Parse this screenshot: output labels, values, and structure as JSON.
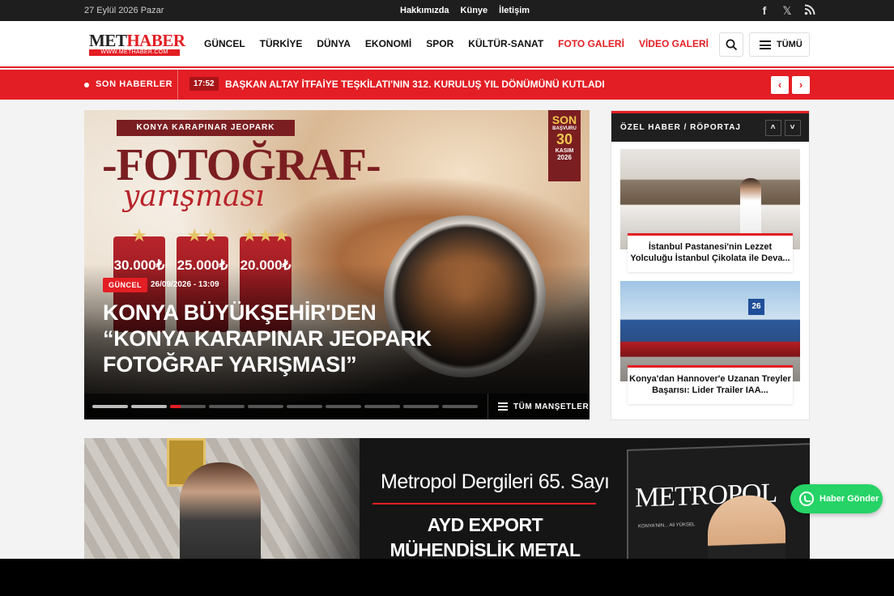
{
  "topbar": {
    "date": "27 Eylül 2026 Pazar",
    "links": [
      "Hakkımızda",
      "Künye",
      "İletişim"
    ],
    "social": [
      {
        "icon": "facebook-icon",
        "glyph": "f"
      },
      {
        "icon": "x-twitter-icon",
        "glyph": "𝕏"
      },
      {
        "icon": "rss-icon",
        "glyph": "◠"
      }
    ]
  },
  "header": {
    "logo_main": "METHABER",
    "logo_sub": "WWW.METHABER.COM",
    "nav": [
      {
        "label": "GÜNCEL",
        "highlight": false
      },
      {
        "label": "TÜRKİYE",
        "highlight": false
      },
      {
        "label": "DÜNYA",
        "highlight": false
      },
      {
        "label": "EKONOMİ",
        "highlight": false
      },
      {
        "label": "SPOR",
        "highlight": false
      },
      {
        "label": "KÜLTÜR-SANAT",
        "highlight": false
      },
      {
        "label": "FOTO GALERİ",
        "highlight": true
      },
      {
        "label": "VİDEO GALERİ",
        "highlight": true
      }
    ],
    "all_label": "TÜMÜ"
  },
  "breaking": {
    "label": "SON HABERLER",
    "time": "17:52",
    "headline": "BAŞKAN ALTAY İTFAİYE TEŞKİLATI'NIN 312. KURULUŞ YIL DÖNÜMÜNÜ KUTLADI",
    "prev": "‹",
    "next": "›"
  },
  "slider": {
    "poster_top": "KONYA KARAPINAR JEOPARK",
    "poster_title": "-FOTOĞRAF-",
    "poster_subtitle": "yarışması",
    "prizes": [
      "30.000₺",
      "25.000₺",
      "20.000₺"
    ],
    "deadline": {
      "line1": "SON",
      "line2": "BAŞVURU",
      "day": "30",
      "month": "KASIM",
      "year": "2026"
    },
    "category": "GÜNCEL",
    "date": "26/09/2026 - 13:09",
    "title": "KONYA BÜYÜKŞEHİR'DEN “KONYA KARAPINAR JEOPARK FOTOĞRAF YARIŞMASI”",
    "pages_total": 10,
    "page_active": 3,
    "all_label": "TÜM MANŞETLER"
  },
  "side": {
    "title": "ÖZEL HABER / RÖPORTAJ",
    "up": "˄",
    "down": "˅",
    "items": [
      {
        "caption": "İstanbul Pastanesi'nin Lezzet Yolculuğu İstanbul Çikolata ile Deva..."
      },
      {
        "caption": "Konya'dan Hannover'e Uzanan Treyler Başarısı: Lider Trailer IAA..."
      }
    ]
  },
  "ad": {
    "line1": "Metropol Dergileri 65. Sayı",
    "line2": "AYD EXPORT",
    "line3": "MÜHENDİSLİK METAL YAPI",
    "magazine": "METROPOL",
    "mag_small": "KONYA'NIN... Ali YÜKSEL"
  },
  "whatsapp": {
    "label": "Haber Gönder"
  },
  "colors": {
    "accent": "#e31e24",
    "dark": "#1e1e1e",
    "whatsapp": "#25d366"
  }
}
